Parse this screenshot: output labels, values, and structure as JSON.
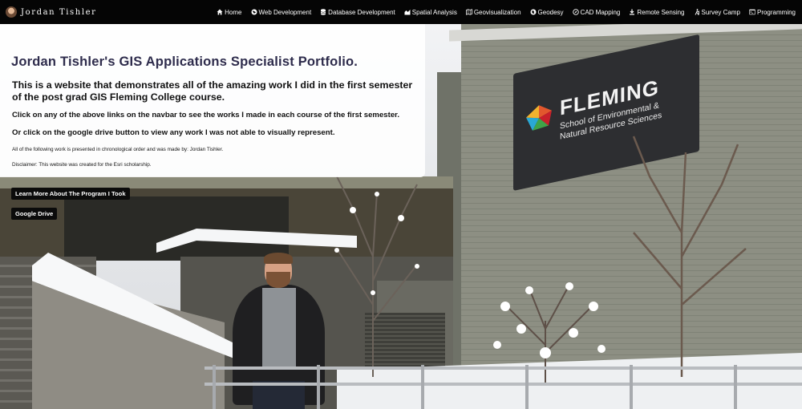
{
  "brand": {
    "name": "Jordan Tishler",
    "avatar_icon": "profile-photo"
  },
  "nav": {
    "items": [
      {
        "label": "Home",
        "icon": "home-icon"
      },
      {
        "label": "Web Development",
        "icon": "globe-icon"
      },
      {
        "label": "Database Development",
        "icon": "database-icon"
      },
      {
        "label": "Spatial Analysis",
        "icon": "area-chart-icon"
      },
      {
        "label": "Geovisualization",
        "icon": "map-icon"
      },
      {
        "label": "Geodesy",
        "icon": "globe-icon"
      },
      {
        "label": "CAD Mapping",
        "icon": "compass-icon"
      },
      {
        "label": "Remote Sensing",
        "icon": "satellite-icon"
      },
      {
        "label": "Survey Camp",
        "icon": "hiking-icon"
      },
      {
        "label": "Programming",
        "icon": "terminal-icon"
      }
    ]
  },
  "hero": {
    "title": "Jordan Tishler's GIS Applications Specialist Portfolio.",
    "subtitle_line1": "This is a website that demonstrates all of the amazing work I did in the first semester",
    "subtitle_line2": "of the post grad GIS Fleming College course.",
    "instruction1": "Click on any of the above links on the navbar to see the works I made in each course of the first semester.",
    "instruction2": "Or click on the google drive button to view any work I was not able to visually represent.",
    "note": "All of the following work is presented in chronological order and was made by: Jordan Tishler.",
    "disclaimer": "Disclaimer: This website was created for the Esri scholarship."
  },
  "buttons": {
    "program": "Learn More About The Program I Took",
    "drive": "Google Drive"
  },
  "background": {
    "sign_title": "FLEMING",
    "sign_line1": "School of Environmental &",
    "sign_line2": "Natural Resource Sciences"
  },
  "colors": {
    "navbar": "#050505",
    "title": "#2e2c4c",
    "button": "#0b0b0b"
  }
}
